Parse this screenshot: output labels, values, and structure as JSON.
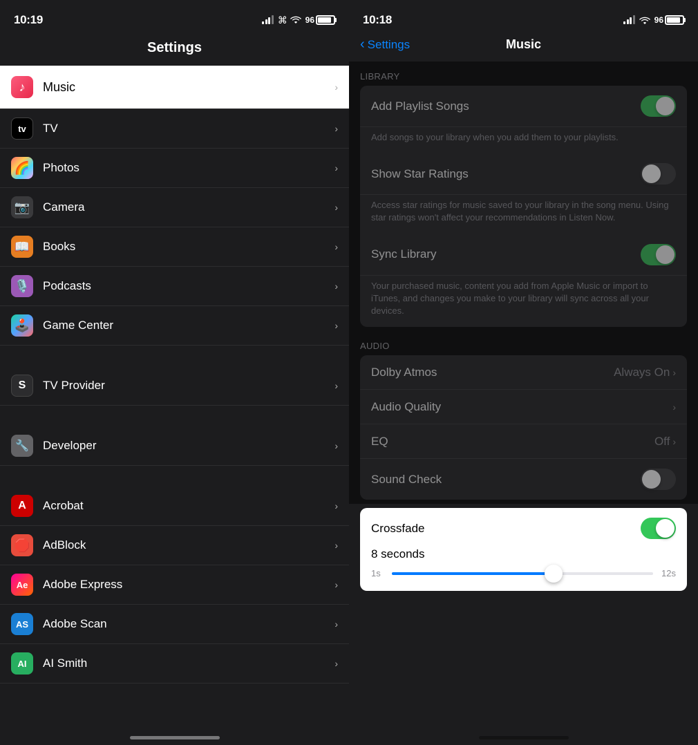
{
  "left": {
    "statusBar": {
      "time": "10:19",
      "battery": "96"
    },
    "title": "Settings",
    "highlightedItem": {
      "label": "Music",
      "icon": "music-note"
    },
    "items": [
      {
        "label": "TV",
        "iconBg": "#000",
        "iconText": "📺",
        "iconType": "appletv"
      },
      {
        "label": "Photos",
        "iconBg": "",
        "iconText": "🌈",
        "iconType": "photos"
      },
      {
        "label": "Camera",
        "iconBg": "#1c1c1e",
        "iconText": "📷",
        "iconType": "camera"
      },
      {
        "label": "Books",
        "iconBg": "#e67e22",
        "iconText": "📖",
        "iconType": "books"
      },
      {
        "label": "Podcasts",
        "iconBg": "#9b59b6",
        "iconText": "🎙️",
        "iconType": "podcasts"
      },
      {
        "label": "Game Center",
        "iconBg": "",
        "iconText": "🕹️",
        "iconType": "gamecenter"
      }
    ],
    "groupItems": [
      {
        "label": "TV Provider",
        "iconBg": "#2c2c2e",
        "iconText": "S",
        "iconType": "tvprovider"
      }
    ],
    "group2Items": [
      {
        "label": "Developer",
        "iconBg": "#636366",
        "iconText": "🔧",
        "iconType": "developer"
      }
    ],
    "appItems": [
      {
        "label": "Acrobat",
        "iconBg": "#cc0000",
        "iconText": "A",
        "iconType": "acrobat"
      },
      {
        "label": "AdBlock",
        "iconBg": "#e74c3c",
        "iconText": "🛑",
        "iconType": "adblock"
      },
      {
        "label": "Adobe Express",
        "iconBg": "#ff0099",
        "iconText": "Ae",
        "iconType": "adobeexpress"
      },
      {
        "label": "Adobe Scan",
        "iconBg": "#e74c3c",
        "iconText": "AS",
        "iconType": "adobescan"
      },
      {
        "label": "AI Smith",
        "iconBg": "#27ae60",
        "iconText": "AI",
        "iconType": "aismith"
      }
    ]
  },
  "right": {
    "statusBar": {
      "time": "10:18",
      "battery": "96"
    },
    "backLabel": "Settings",
    "title": "Music",
    "sections": {
      "library": {
        "label": "LIBRARY",
        "items": [
          {
            "label": "Add Playlist Songs",
            "toggleState": "on",
            "subtext": "Add songs to your library when you add them to your playlists."
          },
          {
            "label": "Show Star Ratings",
            "toggleState": "off",
            "subtext": "Access star ratings for music saved to your library in the song menu. Using star ratings won't affect your recommendations in Listen Now."
          },
          {
            "label": "Sync Library",
            "toggleState": "on",
            "subtext": "Your purchased music, content you add from Apple Music or import to iTunes, and changes you make to your library will sync across all your devices."
          }
        ]
      },
      "audio": {
        "label": "AUDIO",
        "items": [
          {
            "label": "Dolby Atmos",
            "value": "Always On",
            "hasChevron": true
          },
          {
            "label": "Audio Quality",
            "value": "",
            "hasChevron": true
          },
          {
            "label": "EQ",
            "value": "Off",
            "hasChevron": true
          },
          {
            "label": "Sound Check",
            "value": "",
            "hasChevron": false,
            "toggleState": "off"
          }
        ]
      }
    },
    "crossfade": {
      "label": "Crossfade",
      "toggleState": "on",
      "secondsLabel": "8 seconds",
      "sliderMin": "1s",
      "sliderMax": "12s",
      "sliderValue": 62
    }
  }
}
